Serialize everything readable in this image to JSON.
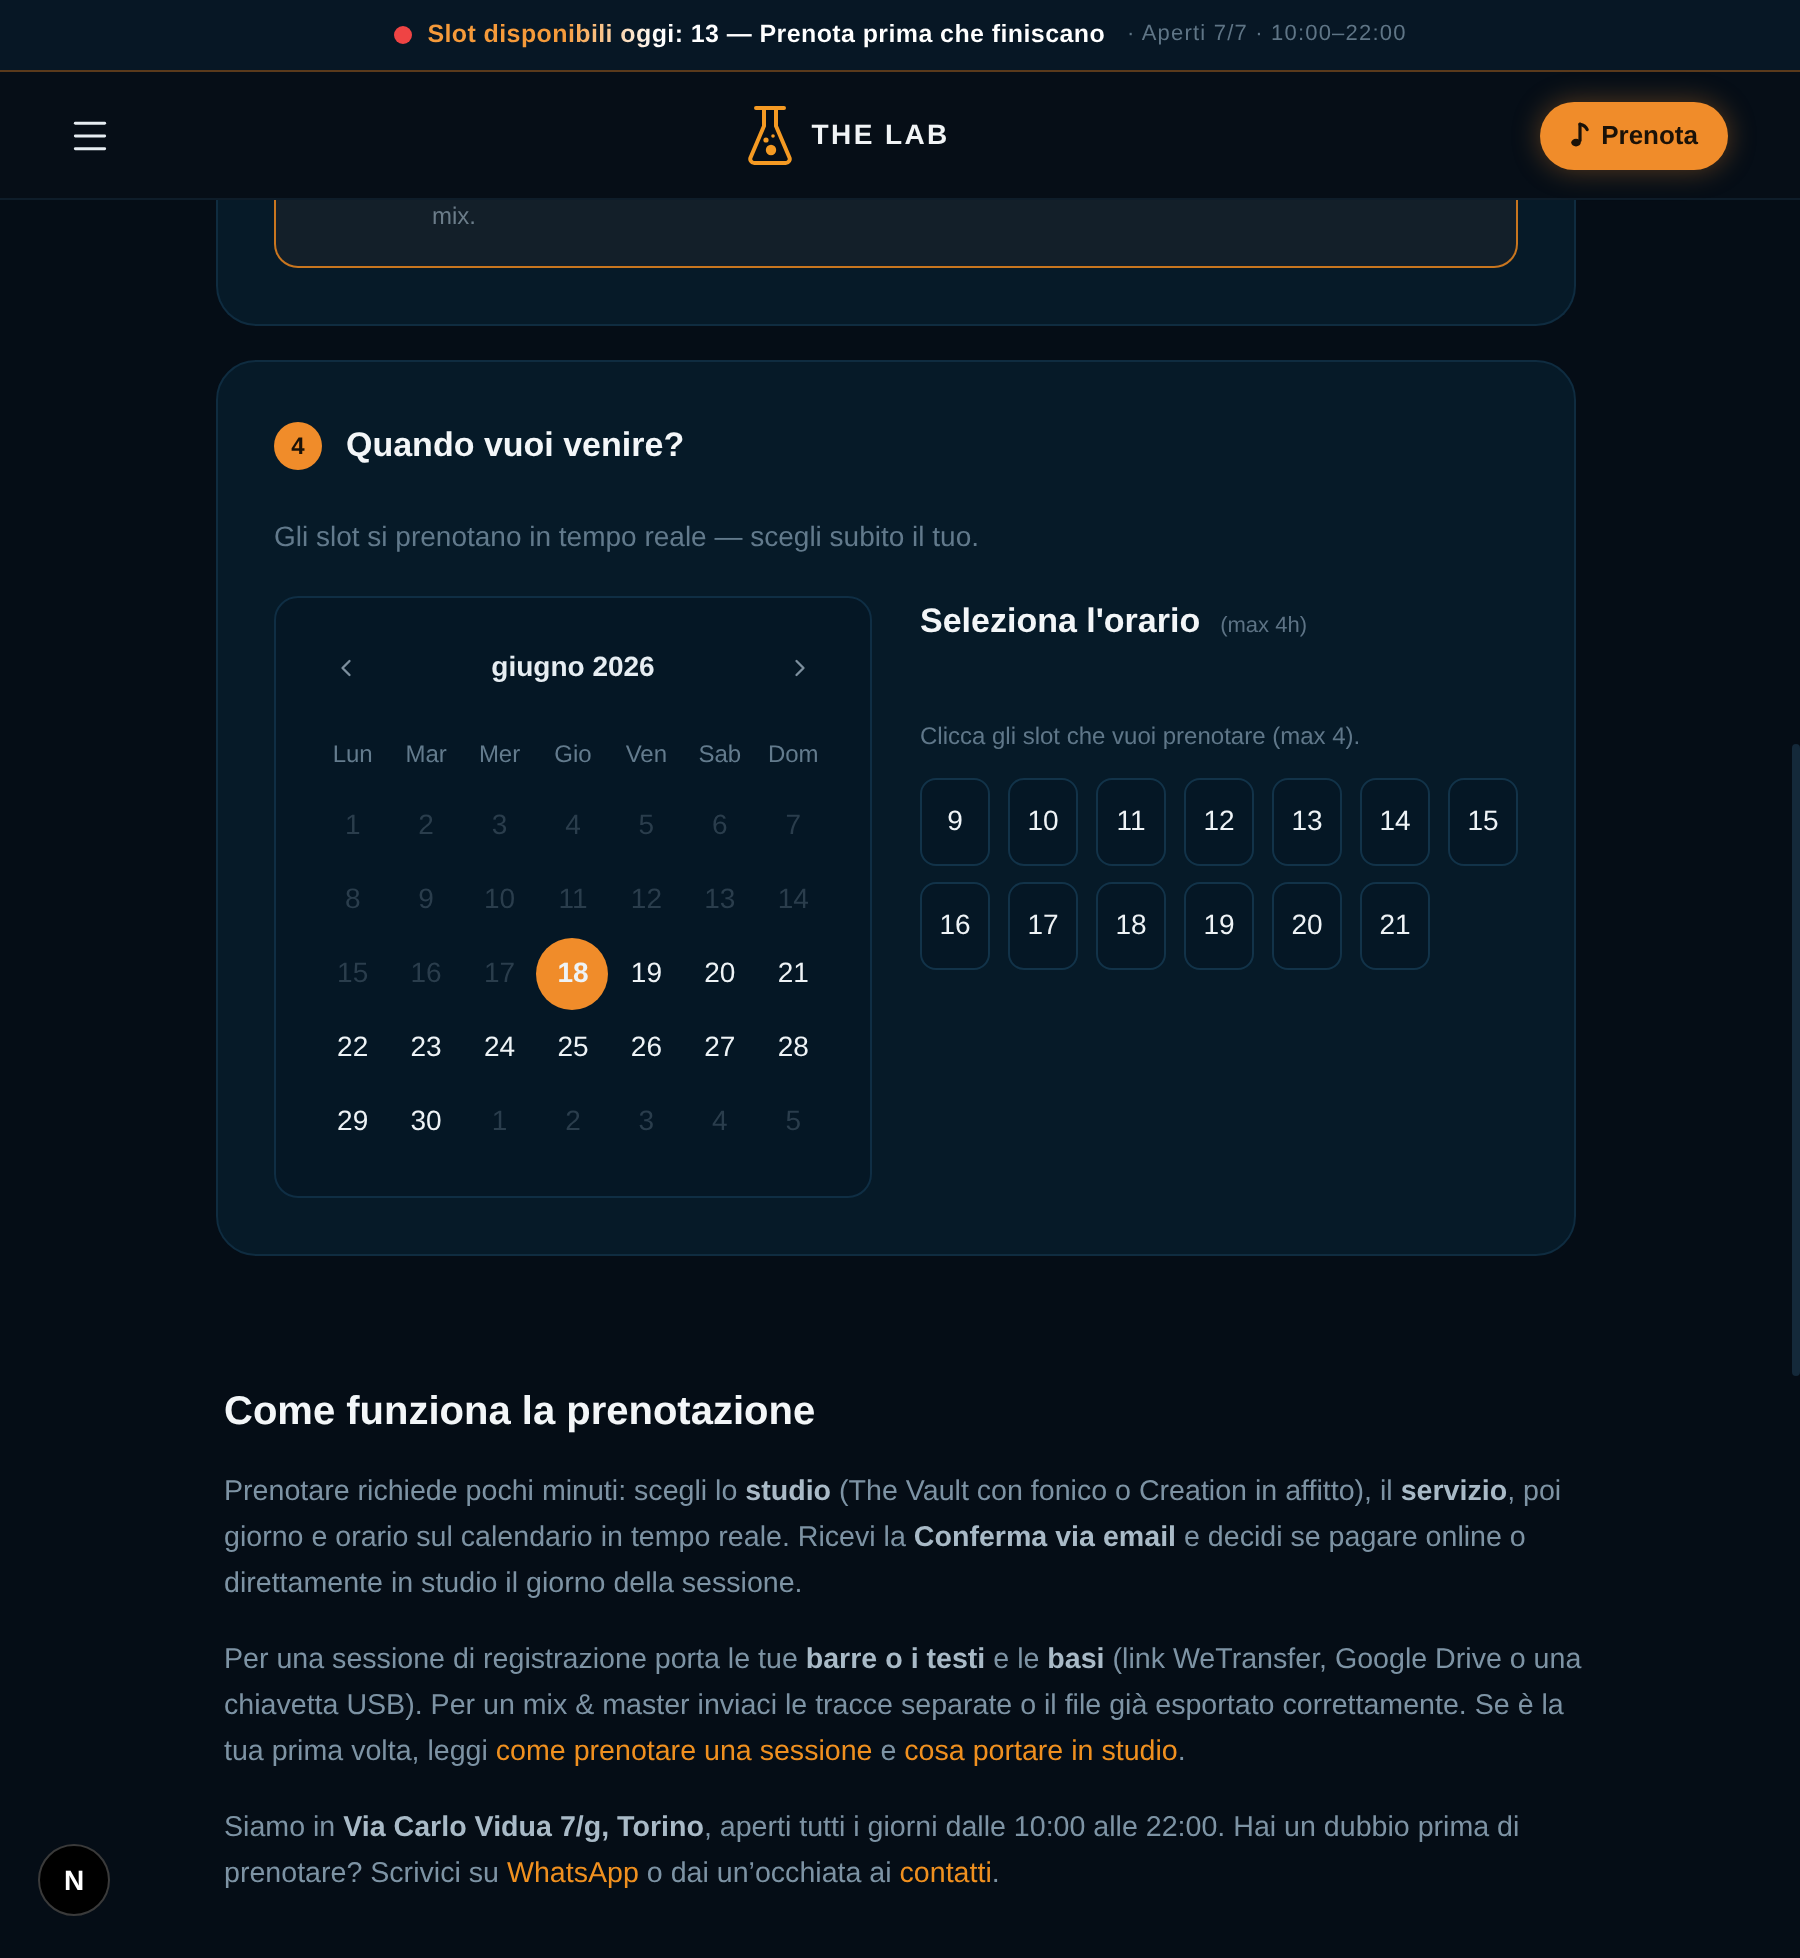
{
  "announcement": {
    "text": "Slot disponibili oggi: **13** — Prenota prima che finiscano",
    "hours": "· Aperti 7/7 · 10:00–22:00"
  },
  "header": {
    "brand": "THE LAB",
    "cta": "Prenota"
  },
  "previous_step": {
    "description_tail": "mix."
  },
  "step": {
    "number": "4",
    "title": "Quando vuoi venire?",
    "subtitle": "Gli slot si prenotano in tempo reale — scegli subito il tuo."
  },
  "calendar": {
    "month": "giugno 2026",
    "weekdays": [
      "Lun",
      "Mar",
      "Mer",
      "Gio",
      "Ven",
      "Sab",
      "Dom"
    ],
    "days": [
      {
        "label": "1",
        "disabled": true,
        "selected": false
      },
      {
        "label": "2",
        "disabled": true,
        "selected": false
      },
      {
        "label": "3",
        "disabled": true,
        "selected": false
      },
      {
        "label": "4",
        "disabled": true,
        "selected": false
      },
      {
        "label": "5",
        "disabled": true,
        "selected": false
      },
      {
        "label": "6",
        "disabled": true,
        "selected": false
      },
      {
        "label": "7",
        "disabled": true,
        "selected": false
      },
      {
        "label": "8",
        "disabled": true,
        "selected": false
      },
      {
        "label": "9",
        "disabled": true,
        "selected": false
      },
      {
        "label": "10",
        "disabled": true,
        "selected": false
      },
      {
        "label": "11",
        "disabled": true,
        "selected": false
      },
      {
        "label": "12",
        "disabled": true,
        "selected": false
      },
      {
        "label": "13",
        "disabled": true,
        "selected": false
      },
      {
        "label": "14",
        "disabled": true,
        "selected": false
      },
      {
        "label": "15",
        "disabled": true,
        "selected": false
      },
      {
        "label": "16",
        "disabled": true,
        "selected": false
      },
      {
        "label": "17",
        "disabled": true,
        "selected": false
      },
      {
        "label": "18",
        "disabled": false,
        "selected": true
      },
      {
        "label": "19",
        "disabled": false,
        "selected": false
      },
      {
        "label": "20",
        "disabled": false,
        "selected": false
      },
      {
        "label": "21",
        "disabled": false,
        "selected": false
      },
      {
        "label": "22",
        "disabled": false,
        "selected": false
      },
      {
        "label": "23",
        "disabled": false,
        "selected": false
      },
      {
        "label": "24",
        "disabled": false,
        "selected": false
      },
      {
        "label": "25",
        "disabled": false,
        "selected": false
      },
      {
        "label": "26",
        "disabled": false,
        "selected": false
      },
      {
        "label": "27",
        "disabled": false,
        "selected": false
      },
      {
        "label": "28",
        "disabled": false,
        "selected": false
      },
      {
        "label": "29",
        "disabled": false,
        "selected": false
      },
      {
        "label": "30",
        "disabled": false,
        "selected": false
      },
      {
        "label": "1",
        "disabled": true,
        "selected": false
      },
      {
        "label": "2",
        "disabled": true,
        "selected": false
      },
      {
        "label": "3",
        "disabled": true,
        "selected": false
      },
      {
        "label": "4",
        "disabled": true,
        "selected": false
      },
      {
        "label": "5",
        "disabled": true,
        "selected": false
      }
    ]
  },
  "time_slots": {
    "title": "Seleziona l'orario",
    "note": "(max 4h)",
    "hint": "Clicca gli slot che vuoi prenotare (max 4).",
    "slots": [
      {
        "label": "9",
        "selected": false
      },
      {
        "label": "10",
        "selected": false
      },
      {
        "label": "11",
        "selected": false
      },
      {
        "label": "12",
        "selected": false
      },
      {
        "label": "13",
        "selected": false
      },
      {
        "label": "14",
        "selected": false
      },
      {
        "label": "15",
        "selected": false
      },
      {
        "label": "16",
        "selected": false
      },
      {
        "label": "17",
        "selected": false
      },
      {
        "label": "18",
        "selected": false
      },
      {
        "label": "19",
        "selected": false
      },
      {
        "label": "20",
        "selected": false
      },
      {
        "label": "21",
        "selected": false
      }
    ]
  },
  "info": {
    "title": "Come funziona la prenotazione",
    "paragraphs": [
      {
        "runs": [
          {
            "kind": "text",
            "text": "Prenotare richiede pochi minuti: scegli lo **studio** (The Vault con fonico o Creation in affitto), il **servizio**, poi giorno e orario sul calendario in tempo reale. Ricevi la **Conferma via email** e decidi se pagare online o direttamente in studio il giorno della sessione."
          }
        ]
      },
      {
        "runs": [
          {
            "kind": "text",
            "text": "Per una sessione di registrazione porta le tue **barre o i testi** e le **basi** (link WeTransfer, Google Drive o una chiavetta USB). Per un mix & master inviaci le tracce separate o il file già esportato correttamente. Se è la tua prima volta, leggi "
          },
          {
            "kind": "link",
            "text": "come prenotare una sessione"
          },
          {
            "kind": "text",
            "text": " e "
          },
          {
            "kind": "link",
            "text": "cosa portare in studio"
          },
          {
            "kind": "text",
            "text": "."
          }
        ]
      },
      {
        "runs": [
          {
            "kind": "text",
            "text": "Siamo in **Via Carlo Vidua 7/g, Torino**, aperti tutti i giorni dalle 10:00 alle 22:00. Hai un dubbio prima di prenotare? Scrivici su "
          },
          {
            "kind": "link",
            "text": "WhatsApp"
          },
          {
            "kind": "text",
            "text": " o dai un’occhiata ai "
          },
          {
            "kind": "link",
            "text": "contatti"
          },
          {
            "kind": "text",
            "text": "."
          }
        ]
      }
    ]
  },
  "dev_badge": {
    "label": "N"
  }
}
